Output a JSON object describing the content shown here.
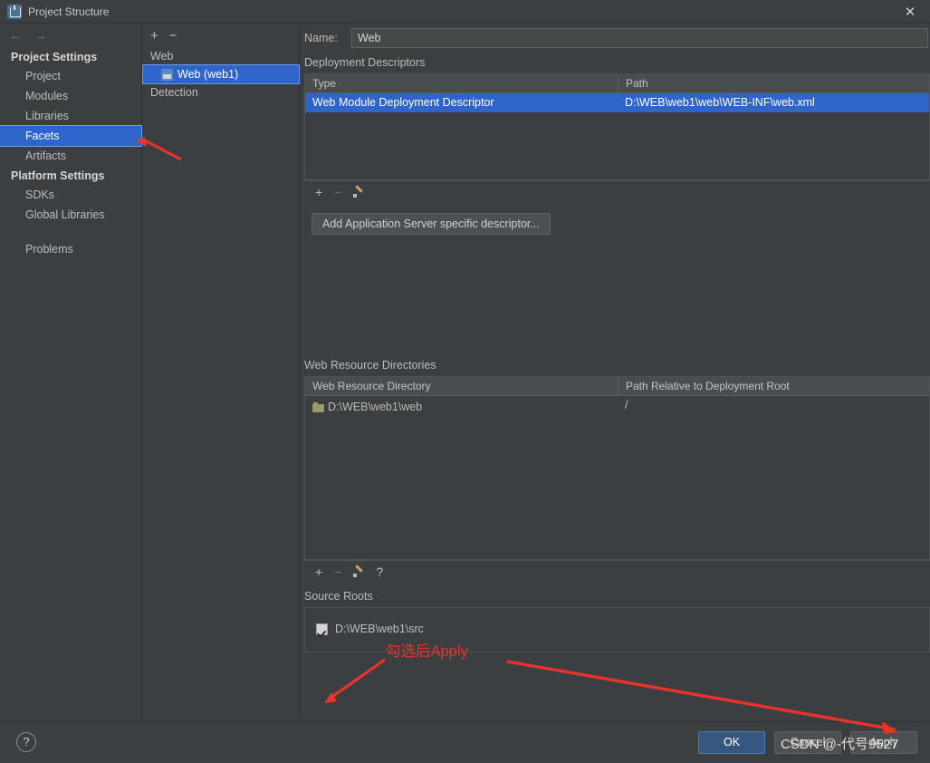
{
  "window": {
    "title": "Project Structure",
    "icon": "idea-app-icon",
    "close_label": "✕"
  },
  "left_nav": {
    "back_icon": "arrow-left-icon",
    "forward_icon": "arrow-right-icon",
    "groups": [
      {
        "title": "Project Settings",
        "items": [
          "Project",
          "Modules",
          "Libraries",
          "Facets",
          "Artifacts"
        ],
        "selected": "Facets"
      },
      {
        "title": "Platform Settings",
        "items": [
          "SDKs",
          "Global Libraries"
        ],
        "selected": null
      }
    ],
    "problems_label": "Problems"
  },
  "mid_panel": {
    "add_icon": "plus-icon",
    "remove_icon": "minus-icon",
    "rows": [
      {
        "label": "Web",
        "level": 0,
        "selected": false,
        "icon": null
      },
      {
        "label": "Web (web1)",
        "level": 1,
        "selected": true,
        "icon": "web-facet-icon"
      },
      {
        "label": "Detection",
        "level": 0,
        "selected": false,
        "icon": null
      }
    ]
  },
  "content": {
    "name_label": "Name:",
    "name_value": "Web",
    "deployment_descriptors": {
      "label": "Deployment Descriptors",
      "columns": [
        "Type",
        "Path"
      ],
      "rows": [
        {
          "type": "Web Module Deployment Descriptor",
          "path": "D:\\WEB\\web1\\web\\WEB-INF\\web.xml",
          "selected": true
        }
      ],
      "toolbar": [
        "plus-icon",
        "minus-icon",
        "pencil-icon"
      ],
      "add_button": "Add Application Server specific descriptor..."
    },
    "web_resource_directories": {
      "label": "Web Resource Directories",
      "columns": [
        "Web Resource Directory",
        "Path Relative to Deployment Root"
      ],
      "rows": [
        {
          "directory": "D:\\WEB\\web1\\web",
          "relative": "/",
          "icon": "folder-icon"
        }
      ],
      "toolbar": [
        "plus-icon",
        "minus-icon",
        "pencil-icon",
        "help-icon"
      ]
    },
    "source_roots": {
      "label": "Source Roots",
      "items": [
        {
          "label": "D:\\WEB\\web1\\src",
          "checked": true
        }
      ]
    }
  },
  "bottom_bar": {
    "help_icon": "question-mark-icon",
    "ok": "OK",
    "cancel": "Cancel",
    "apply": "Apply"
  },
  "annotations": {
    "note": "勾选后Apply",
    "arrow_color": "#e8322a",
    "watermark": "CSDN @-代号9527"
  }
}
